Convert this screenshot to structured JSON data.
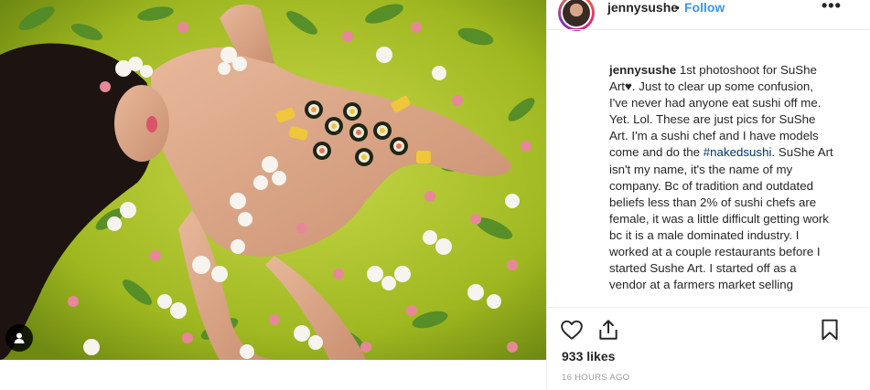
{
  "post": {
    "username": "jennysushe",
    "separator": "•",
    "follow_label": "Follow",
    "more_label": "•••",
    "caption": {
      "user": "jennysushe",
      "text_a": " 1st photoshoot for SuShe Art",
      "heart": "♥",
      "text_b": ". Just to clear up some confusion, I've never had anyone eat sushi off me. Yet. Lol. These are just pics for SuShe Art. I'm a sushi chef and I have models come and do the ",
      "hashtag": "#nakedsushi",
      "text_c": ". SuShe Art isn't my name, it's the name of my company. Bc of tradition and outdated beliefs less than 2% of sushi chefs are female, it was a little difficult getting work bc it is a male dominated industry. I worked at a couple restaurants before I started Sushe Art. I started off as a vendor at a farmers market selling"
    },
    "likes": "933 likes",
    "timestamp": "16 HOURS AGO"
  },
  "icons": {
    "like": "heart-outline-icon",
    "share": "share-upload-icon",
    "save": "bookmark-icon",
    "tag": "user-tag-icon"
  },
  "colors": {
    "link": "#3897f0",
    "hashtag": "#003569",
    "text": "#262626",
    "muted": "#999999",
    "background": "#a9c21a"
  }
}
